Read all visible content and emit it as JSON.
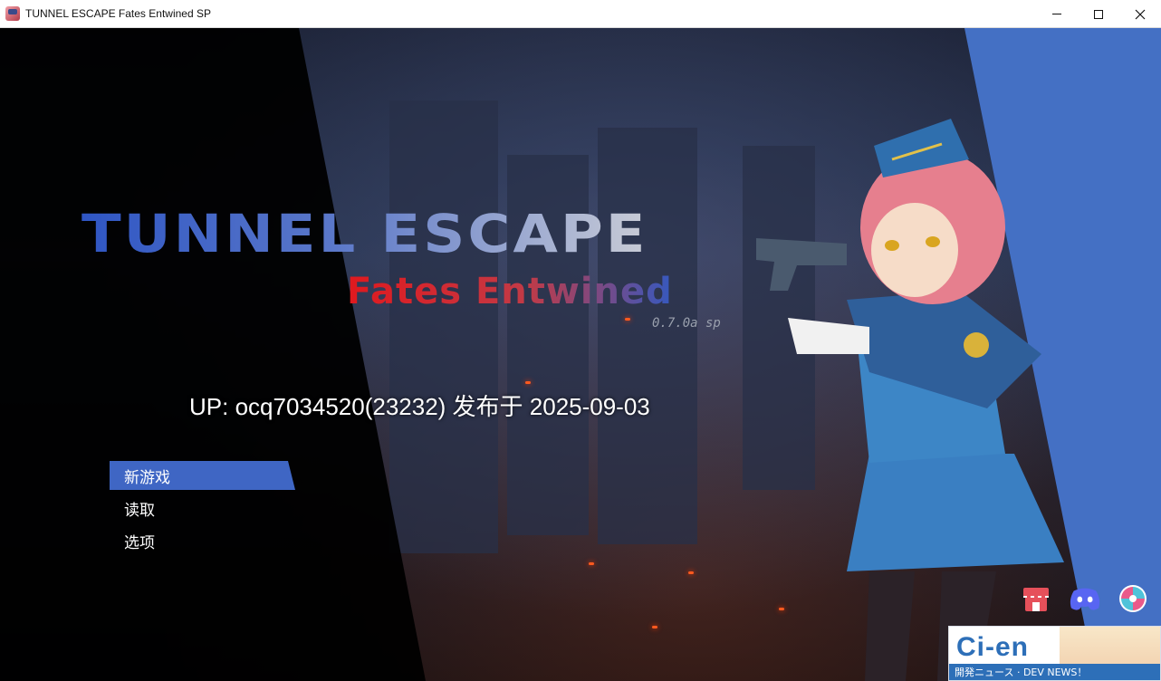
{
  "window": {
    "title": "TUNNEL ESCAPE Fates Entwined SP",
    "controls": {
      "minimize": "—",
      "maximize": "☐",
      "close": "✕"
    }
  },
  "logo": {
    "title": "TUNNEL ESCAPE",
    "subtitle": "Fates Entwined",
    "version": "0.7.0a sp"
  },
  "uploader_line": "UP: ocq7034520(23232) 发布于 2025-09-03",
  "menu": {
    "items": [
      {
        "label": "新游戏",
        "selected": true
      },
      {
        "label": "读取",
        "selected": false
      },
      {
        "label": "选项",
        "selected": false
      }
    ]
  },
  "social": {
    "icons": [
      "shop-icon",
      "discord-icon",
      "swirl-icon"
    ]
  },
  "cien_banner": {
    "logo": "Ci-en",
    "strip_text": "開発ニュース · DEV NEWS！"
  },
  "colors": {
    "accent_blue": "#3f66c4",
    "panel_blue": "#4470c4",
    "logo_red": "#e0191e"
  }
}
